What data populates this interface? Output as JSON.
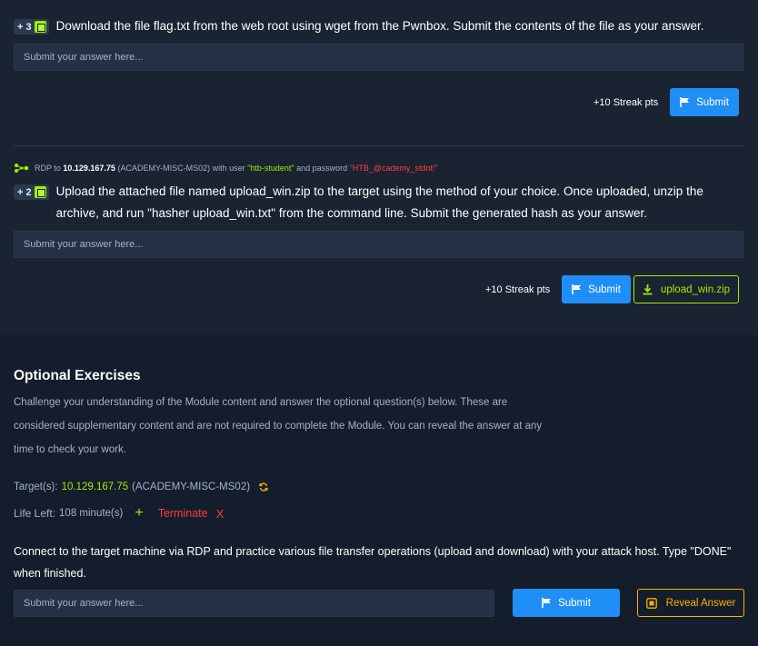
{
  "questions": [
    {
      "points": "+ 3",
      "text": "Download the file flag.txt from the web root using wget from the Pwnbox. Submit the contents of the file as your answer.",
      "placeholder": "Submit your answer here...",
      "streak": "+10 Streak pts",
      "submit_label": "Submit"
    },
    {
      "rdp": {
        "prefix": "RDP to",
        "ip": "10.129.167.75",
        "name": "(ACADEMY-MISC-MS02)",
        "with_user": "with user",
        "user": "\"htb-student\"",
        "and_password": "and password",
        "password": "\"HTB_@cademy_stdnt!\""
      },
      "points": "+ 2",
      "text": "Upload the attached file named upload_win.zip to the target using the method of your choice. Once uploaded, unzip the archive, and run \"hasher upload_win.txt\" from the command line. Submit the generated hash as your answer.",
      "placeholder": "Submit your answer here...",
      "streak": "+10 Streak pts",
      "submit_label": "Submit",
      "download_label": "upload_win.zip"
    }
  ],
  "optional": {
    "title": "Optional Exercises",
    "description": "Challenge your understanding of the Module content and answer the optional question(s) below. These are considered supplementary content and are not required to complete the Module. You can reveal the answer at any time to check your work.",
    "target_label": "Target(s):",
    "target_ip": "10.129.167.75",
    "target_name": "(ACADEMY-MISC-MS02)",
    "life_label": "Life Left:",
    "life_value": "108 minute(s)",
    "plus": "+",
    "terminate_label": "Terminate",
    "terminate_x": "X",
    "question": "Connect to the target machine via RDP and practice various file transfer operations (upload and download) with your attack host. Type \"DONE\" when finished.",
    "placeholder": "Submit your answer here...",
    "submit_label": "Submit",
    "reveal_label": "Reveal Answer"
  },
  "colors": {
    "page_bg": "#141d2b",
    "panel_bg": "#1a2332",
    "accent_green": "#9fef00",
    "accent_blue": "#1f8ff7",
    "accent_red": "#ff3e3e",
    "accent_orange": "#ffaf00"
  },
  "icons": [
    "cube-icon",
    "flag-icon",
    "network-icon",
    "download-icon",
    "refresh-icon",
    "plus-icon",
    "close-icon",
    "reveal-icon"
  ]
}
